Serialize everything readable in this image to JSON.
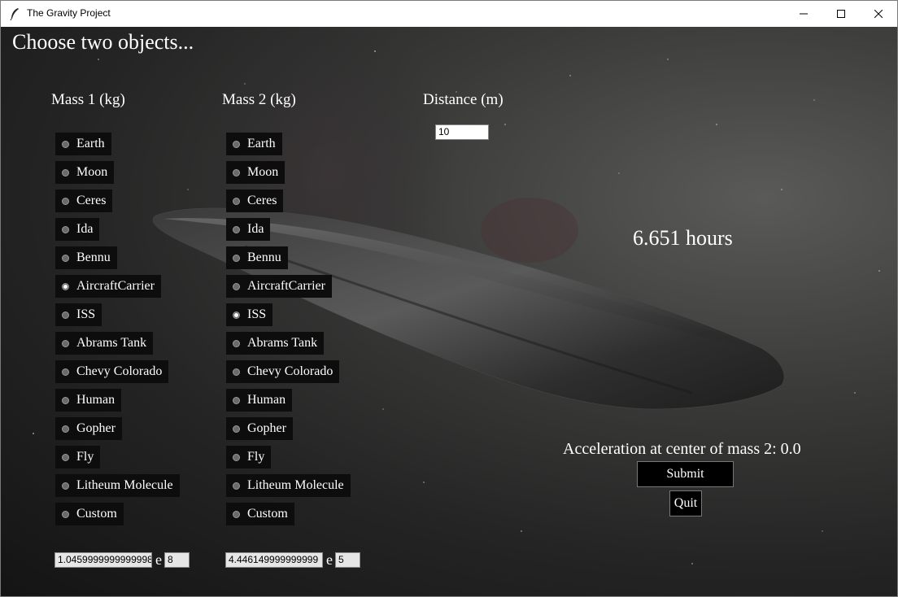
{
  "window": {
    "title": "The Gravity Project"
  },
  "heading": "Choose two objects...",
  "mass1": {
    "label": "Mass 1 (kg)",
    "selected": "AircraftCarrier",
    "options": [
      "Earth",
      "Moon",
      "Ceres",
      "Ida",
      "Bennu",
      "AircraftCarrier",
      "ISS",
      "Abrams Tank",
      "Chevy Colorado",
      "Human",
      "Gopher",
      "Fly",
      "Litheum Molecule",
      "Custom"
    ],
    "mantissa": "1.0459999999999998",
    "exponent_label": "e",
    "exponent": "8"
  },
  "mass2": {
    "label": "Mass 2 (kg)",
    "selected": "ISS",
    "options": [
      "Earth",
      "Moon",
      "Ceres",
      "Ida",
      "Bennu",
      "AircraftCarrier",
      "ISS",
      "Abrams Tank",
      "Chevy Colorado",
      "Human",
      "Gopher",
      "Fly",
      "Litheum Molecule",
      "Custom"
    ],
    "mantissa": "4.446149999999999",
    "exponent_label": "e",
    "exponent": "5"
  },
  "distance": {
    "label": "Distance (m)",
    "value": "10"
  },
  "result": {
    "time": "6.651 hours",
    "acceleration": "Acceleration at center of mass 2: 0.0"
  },
  "buttons": {
    "submit": "Submit",
    "quit": "Quit"
  },
  "colors": {
    "background": "#2b2b2b",
    "button": "#000000",
    "text": "#ffffff"
  }
}
